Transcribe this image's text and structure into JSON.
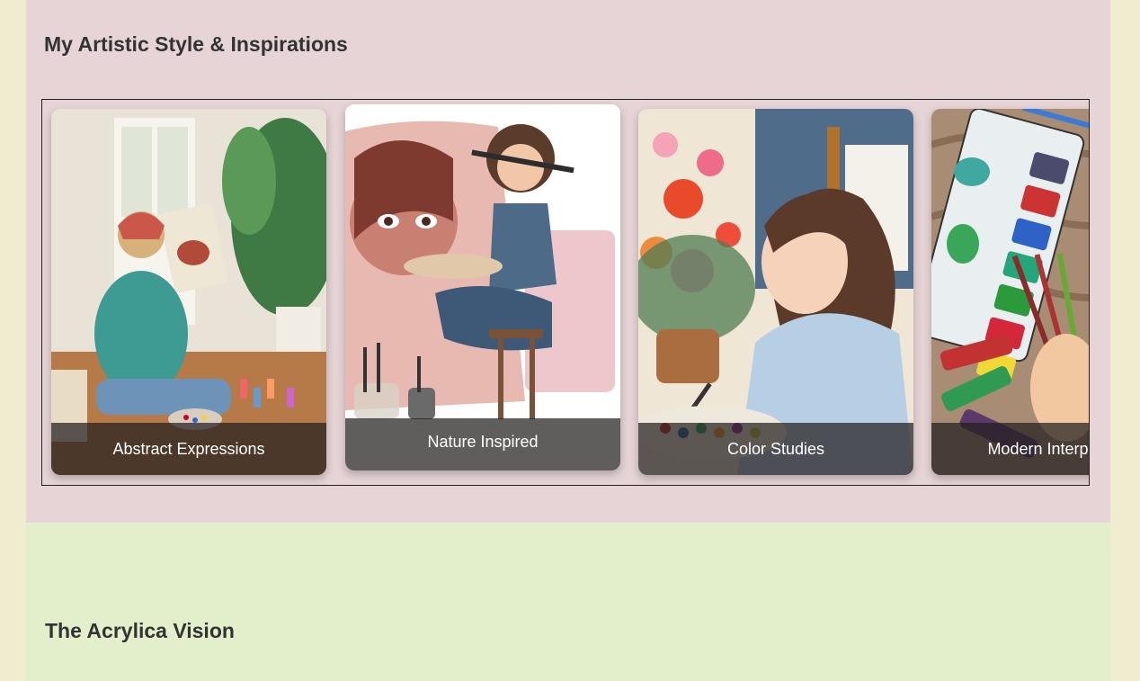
{
  "styles_section": {
    "title": "My Artistic Style & Inspirations",
    "cards": [
      {
        "caption": "Abstract Expressions",
        "image": "painter-on-floor-illustration"
      },
      {
        "caption": "Nature Inspired",
        "image": "girl-with-brush-illustration"
      },
      {
        "caption": "Color Studies",
        "image": "girl-painting-flowers-illustration"
      },
      {
        "caption": "Modern Interpretations",
        "image": "watercolor-palette-illustration"
      }
    ]
  },
  "vision_section": {
    "title": "The Acrylica Vision"
  },
  "colors": {
    "page_background": "#efecd0",
    "styles_background": "#e7d4d6",
    "vision_background": "#e3efca",
    "heading_text": "#333333",
    "caption_overlay": "#231e1e"
  }
}
